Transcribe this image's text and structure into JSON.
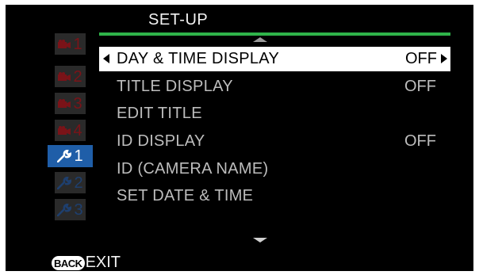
{
  "header": {
    "title": "SET-UP"
  },
  "colors": {
    "accent_green": "#2fb44a",
    "active_tab_blue": "#1f5ea8",
    "camera_tab_red": "#7a1318",
    "wrench_tab_blue": "#1e3f6e"
  },
  "sidebar": {
    "tabs": [
      {
        "icon": "camera-icon",
        "number": "1"
      },
      {
        "icon": "camera-icon",
        "number": "2"
      },
      {
        "icon": "camera-icon",
        "number": "3"
      },
      {
        "icon": "camera-icon",
        "number": "4"
      },
      {
        "icon": "wrench-icon",
        "number": "1",
        "active": true
      },
      {
        "icon": "wrench-icon",
        "number": "2"
      },
      {
        "icon": "wrench-icon",
        "number": "3"
      }
    ]
  },
  "menu": {
    "items": [
      {
        "label": "DAY & TIME DISPLAY",
        "value": "OFF",
        "selected": true
      },
      {
        "label": "TITLE DISPLAY",
        "value": "OFF"
      },
      {
        "label": "EDIT TITLE",
        "value": ""
      },
      {
        "label": "ID DISPLAY",
        "value": "OFF"
      },
      {
        "label": "ID (CAMERA NAME)",
        "value": ""
      },
      {
        "label": "SET DATE & TIME",
        "value": ""
      }
    ]
  },
  "footer": {
    "back_badge": "BACK",
    "exit_label": "EXIT"
  }
}
